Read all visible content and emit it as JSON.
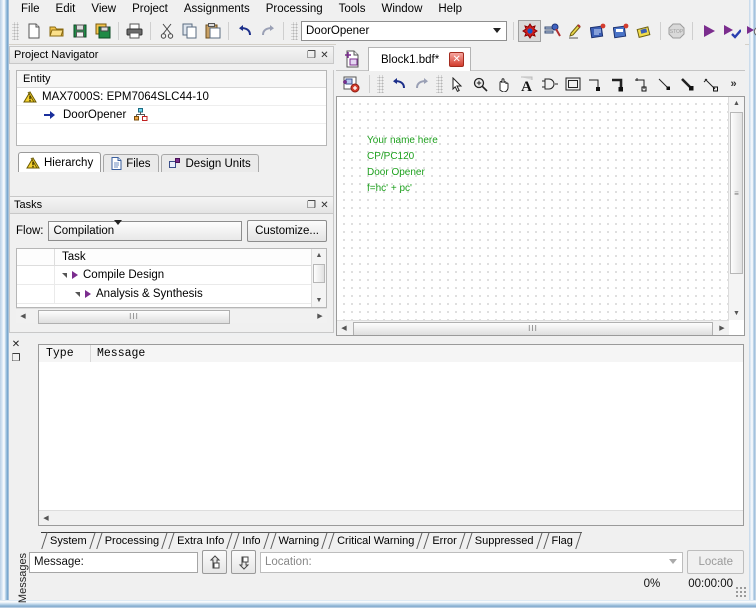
{
  "app": {
    "title": "Quartus II"
  },
  "menubar": {
    "items": [
      "File",
      "Edit",
      "View",
      "Project",
      "Assignments",
      "Processing",
      "Tools",
      "Window",
      "Help"
    ]
  },
  "toolbar": {
    "entity_combo_value": "DoorOpener",
    "buttons": [
      "new-icon",
      "open-icon",
      "save-icon",
      "save-all-icon",
      "print-icon",
      "cut-icon",
      "copy-icon",
      "paste-icon",
      "undo-icon",
      "redo-icon"
    ],
    "right_buttons": [
      "compilation-report-icon",
      "settings-icon",
      "assignment-editor-icon",
      "pin-planner-icon",
      "timing-analyzer-icon",
      "programmer-icon",
      "stop-icon",
      "start-compilation-icon",
      "start-analysis-icon",
      "timing-icon"
    ],
    "overflow_label": "»"
  },
  "project_navigator": {
    "title": "Project Navigator",
    "restore_glyph": "❐",
    "close_glyph": "✕",
    "column_header": "Entity",
    "rows": [
      {
        "icon": "device-warning-icon",
        "label": "MAX7000S: EPM7064SLC44-10",
        "level": 0
      },
      {
        "icon": "entity-arrow-icon",
        "label": "DoorOpener",
        "level": 1,
        "trailing_icon": "hierarchy-icon"
      }
    ],
    "tabs": [
      {
        "label": "Hierarchy",
        "icon": "hierarchy-warning-icon",
        "active": true
      },
      {
        "label": "Files",
        "icon": "file-icon",
        "active": false
      },
      {
        "label": "Design Units",
        "icon": "design-units-icon",
        "active": false
      }
    ]
  },
  "tasks": {
    "title": "Tasks",
    "restore_glyph": "❐",
    "close_glyph": "✕",
    "flow_label": "Flow:",
    "flow_value": "Compilation",
    "customize_label": "Customize...",
    "column_header": "Task",
    "rows": [
      {
        "label": "Compile Design",
        "level": 0
      },
      {
        "label": "Analysis & Synthesis",
        "level": 1
      }
    ],
    "scroll_arrow_up": "▲",
    "scroll_arrow_down": "▼",
    "scroll_arrow_left": "◀",
    "scroll_arrow_right": "▶",
    "thumb_grip": "III"
  },
  "editor": {
    "doc_tab_label": "Block1.bdf*",
    "doc_tab_close_glyph": "✕",
    "new_block_icon": "new-block-diagram-icon",
    "toolbar_left_icon": "insert-symbol-icon",
    "tools": [
      "undo-icon",
      "redo-icon",
      "selection-tool-icon",
      "zoom-tool-icon",
      "hand-tool-icon",
      "text-tool-icon",
      "symbol-tool-icon",
      "block-tool-icon",
      "orthogonal-node-tool-icon",
      "orthogonal-bus-tool-icon",
      "orthogonal-conduit-tool-icon",
      "diagonal-node-tool-icon",
      "diagonal-bus-tool-icon",
      "diagonal-conduit-tool-icon"
    ],
    "overflow_label": "»",
    "canvas_text": [
      "Your name here",
      "CP/PC120",
      "Door Opener",
      "f=hc' + pc'"
    ],
    "canvas_text_color": "#1ea01e",
    "scroll_arrow_up": "▲",
    "scroll_arrow_down": "▼",
    "scroll_arrow_left": "◀",
    "scroll_arrow_right": "▶",
    "thumb_grip": "III"
  },
  "messages": {
    "side_label": "Messages",
    "close_glyph": "✕",
    "restore_glyph": "❐",
    "columns": [
      "Type",
      "Message"
    ],
    "rows": [],
    "tabs": [
      {
        "label": "System",
        "active": true
      },
      {
        "label": "Processing",
        "active": false
      },
      {
        "label": "Extra Info",
        "active": false
      },
      {
        "label": "Info",
        "active": false
      },
      {
        "label": "Warning",
        "active": false
      },
      {
        "label": "Critical Warning",
        "active": false
      },
      {
        "label": "Error",
        "active": false
      },
      {
        "label": "Suppressed",
        "active": false
      },
      {
        "label": "Flag",
        "active": false
      }
    ],
    "message_label": "Message:",
    "message_value": "",
    "prev_button_icon": "find-previous-icon",
    "next_button_icon": "find-next-icon",
    "location_placeholder": "Location:",
    "locate_label": "Locate",
    "progress_percent": "0%",
    "elapsed_time": "00:00:00",
    "scroll_arrow_left": "◀"
  },
  "colors": {
    "accent_purple": "#7b2d8e",
    "canvas_green": "#1ea01e",
    "close_red": "#d23d2e",
    "frame_blue": "#7fa9cd"
  }
}
